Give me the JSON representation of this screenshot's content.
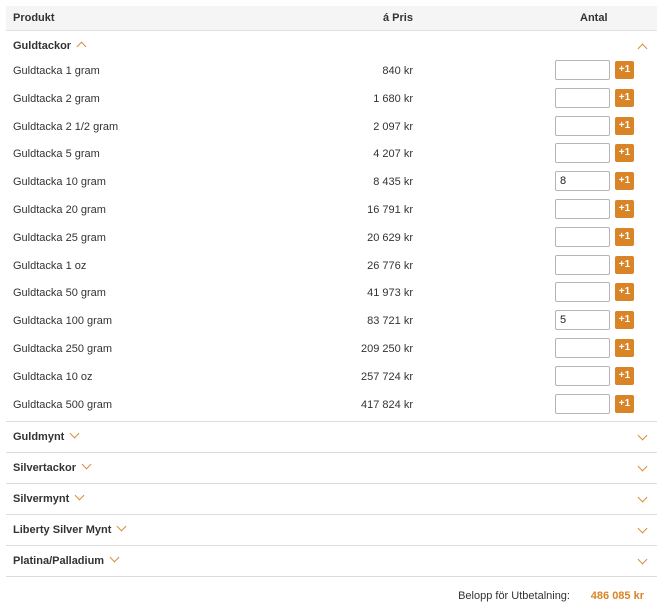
{
  "header": {
    "col_product": "Produkt",
    "col_price": "á Pris",
    "col_qty": "Antal"
  },
  "open_category": {
    "title": "Guldtackor",
    "items": [
      {
        "name": "Guldtacka 1 gram",
        "price": "840 kr",
        "qty": ""
      },
      {
        "name": "Guldtacka 2 gram",
        "price": "1 680 kr",
        "qty": ""
      },
      {
        "name": "Guldtacka 2 1/2 gram",
        "price": "2 097 kr",
        "qty": ""
      },
      {
        "name": "Guldtacka 5 gram",
        "price": "4 207 kr",
        "qty": ""
      },
      {
        "name": "Guldtacka 10 gram",
        "price": "8 435 kr",
        "qty": "8"
      },
      {
        "name": "Guldtacka 20 gram",
        "price": "16 791 kr",
        "qty": ""
      },
      {
        "name": "Guldtacka 25 gram",
        "price": "20 629 kr",
        "qty": ""
      },
      {
        "name": "Guldtacka 1 oz",
        "price": "26 776 kr",
        "qty": ""
      },
      {
        "name": "Guldtacka 50 gram",
        "price": "41 973 kr",
        "qty": ""
      },
      {
        "name": "Guldtacka 100 gram",
        "price": "83 721 kr",
        "qty": "5"
      },
      {
        "name": "Guldtacka 250 gram",
        "price": "209 250 kr",
        "qty": ""
      },
      {
        "name": "Guldtacka 10 oz",
        "price": "257 724 kr",
        "qty": ""
      },
      {
        "name": "Guldtacka 500 gram",
        "price": "417 824 kr",
        "qty": ""
      }
    ],
    "add_label": "+1"
  },
  "collapsed_categories": [
    {
      "title": "Guldmynt"
    },
    {
      "title": "Silvertackor"
    },
    {
      "title": "Silvermynt"
    },
    {
      "title": "Liberty Silver Mynt"
    },
    {
      "title": "Platina/Palladium"
    }
  ],
  "total": {
    "label": "Belopp för Utbetalning:",
    "value": "486 085 kr"
  },
  "colors": {
    "accent": "#d98426",
    "border": "#dcdcdc",
    "header_bg": "#f5f5f5"
  },
  "icons": {
    "expand": "chevron-down-icon",
    "collapse": "chevron-up-icon"
  }
}
